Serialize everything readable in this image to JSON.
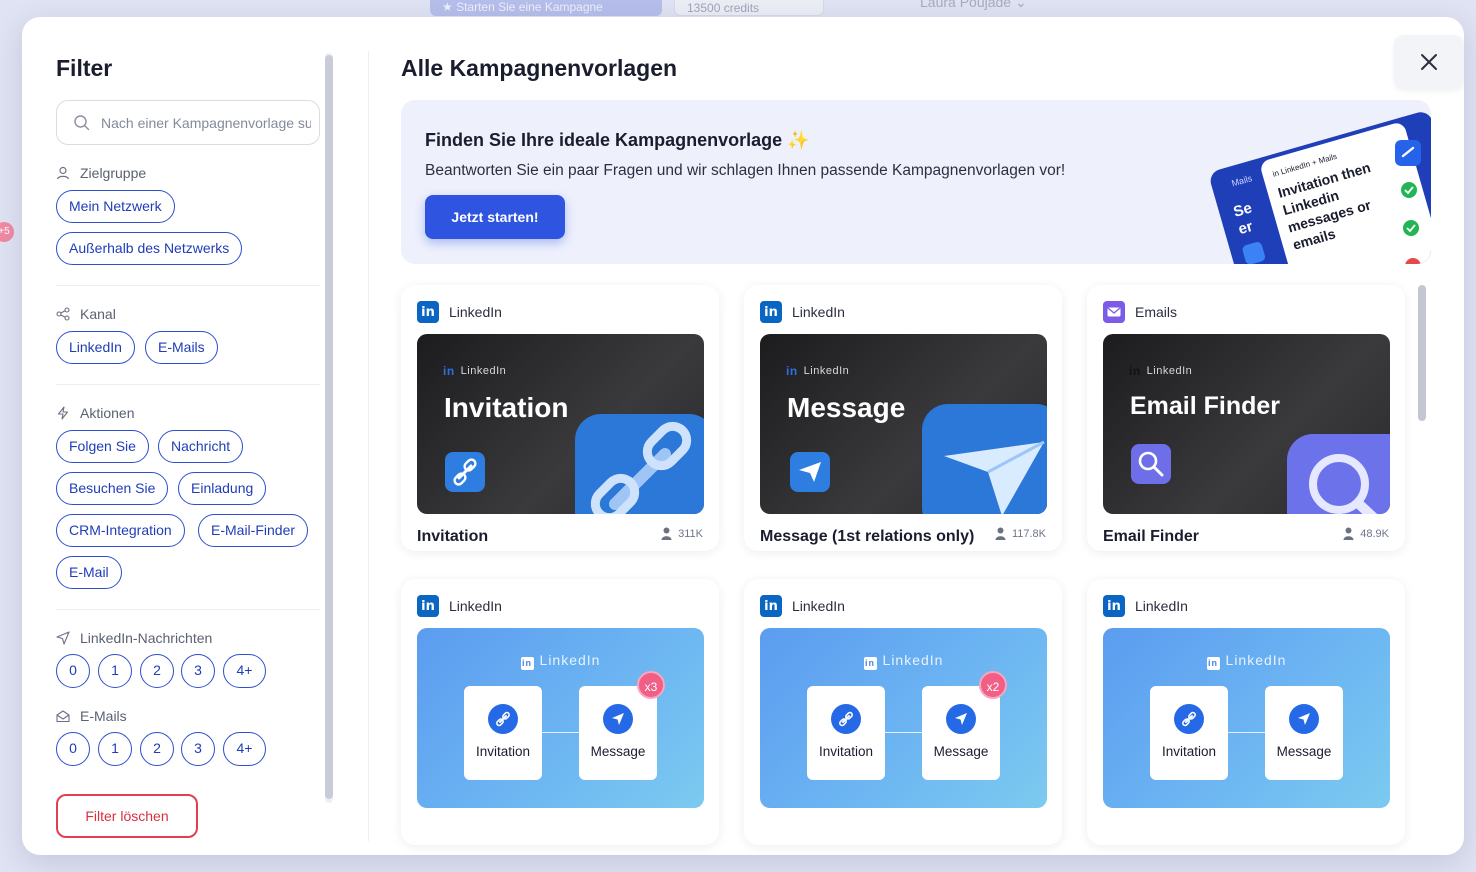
{
  "background": {
    "start_campaign": "Starten Sie eine Kampagne",
    "credits": "13500 credits",
    "user_name": "Laura Poujade",
    "side_badge": "+5"
  },
  "sidebar": {
    "title": "Filter",
    "search_placeholder": "Nach einer Kampagnenvorlage suchen",
    "sections": {
      "audience": {
        "label": "Zielgruppe",
        "chips": [
          "Mein Netzwerk",
          "Außerhalb des Netzwerks"
        ]
      },
      "channel": {
        "label": "Kanal",
        "chips": [
          "LinkedIn",
          "E-Mails"
        ]
      },
      "actions": {
        "label": "Aktionen",
        "chips": [
          "Folgen Sie",
          "Nachricht",
          "Besuchen Sie",
          "Einladung",
          "CRM-Integration",
          "E-Mail-Finder",
          "E-Mail"
        ]
      },
      "linkedin_messages": {
        "label": "LinkedIn-Nachrichten",
        "options": [
          "0",
          "1",
          "2",
          "3",
          "4+"
        ]
      },
      "emails": {
        "label": "E-Mails",
        "options": [
          "0",
          "1",
          "2",
          "3",
          "4+"
        ]
      }
    },
    "clear_button": "Filter löschen"
  },
  "main": {
    "title": "Alle Kampagnenvorlagen",
    "banner": {
      "title": "Finden Sie Ihre ideale Kampagnenvorlage",
      "sparkle": "✨",
      "subtitle": "Beantworten Sie ein paar Fragen und wir schlagen Ihnen passende Kampagnenvorlagen vor!",
      "button": "Jetzt starten!",
      "art": {
        "mails_tag": "Mails",
        "linkedin_mails_tag": "in LinkedIn + Mails",
        "lines": [
          "Invitation then",
          "Linkedin",
          "messages or",
          "emails"
        ],
        "side_text": [
          "Se",
          "er"
        ]
      }
    },
    "cards": [
      {
        "channel": "LinkedIn",
        "tagline": "LinkedIn",
        "headline": "Invitation",
        "name": "Invitation",
        "count": "311K"
      },
      {
        "channel": "LinkedIn",
        "tagline": "LinkedIn",
        "headline": "Message",
        "name": "Message (1st relations only)",
        "count": "117.8K"
      },
      {
        "channel": "Emails",
        "tagline": "LinkedIn",
        "headline": "Email Finder",
        "name": "Email Finder",
        "count": "48.9K"
      },
      {
        "channel": "LinkedIn",
        "tagline": "LinkedIn",
        "step1": "Invitation",
        "step2": "Message",
        "badge": "x3"
      },
      {
        "channel": "LinkedIn",
        "tagline": "LinkedIn",
        "step1": "Invitation",
        "step2": "Message",
        "badge": "x2"
      },
      {
        "channel": "LinkedIn",
        "tagline": "LinkedIn",
        "step1": "Invitation",
        "step2": "Message"
      }
    ]
  },
  "colors": {
    "primary": "#2f55e0",
    "chip_border": "#2d4fcf",
    "danger": "#e04050",
    "linkedin": "#0a66c2",
    "badge_pink": "#f25f86"
  }
}
